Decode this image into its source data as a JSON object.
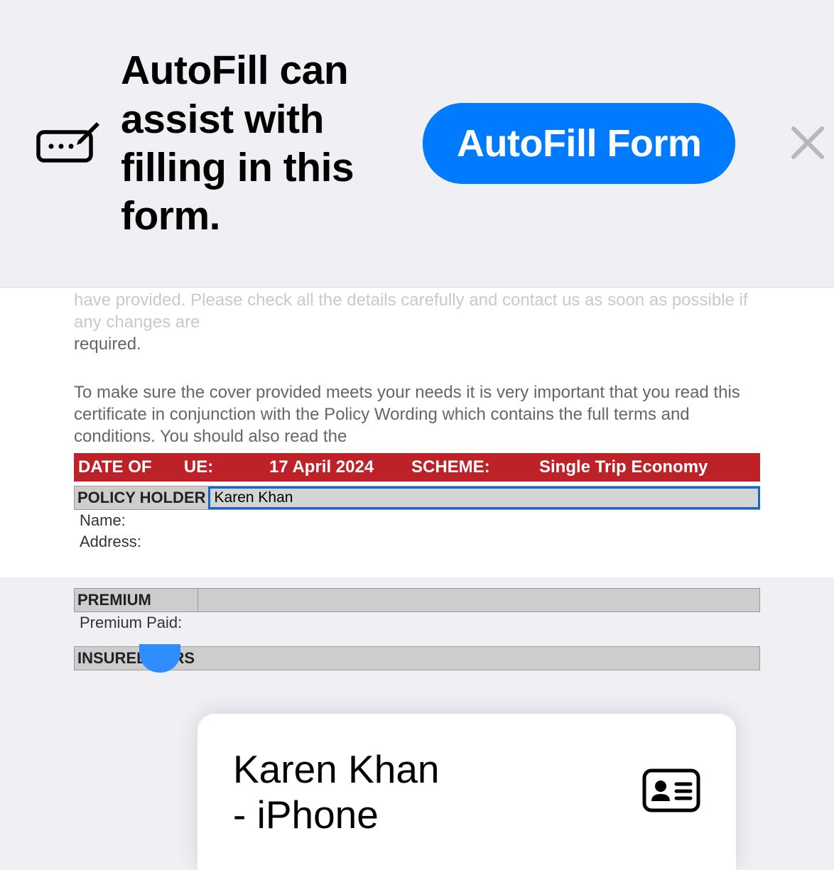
{
  "banner": {
    "message": "AutoFill can assist with filling in this form.",
    "button_label": "AutoFill Form"
  },
  "document": {
    "cutoff_text": "have provided. Please check all the details carefully and contact us as soon as possible if any changes are",
    "para1_cont": "required.",
    "para2": "To make sure the cover provided meets your needs it is very important that you read this certificate in conjunction with the Policy Wording which contains the full terms and conditions. You should also read the",
    "red_bar": {
      "date_label": "DATE OF ISSUE:",
      "date_label_visible": "DATE OF",
      "date_label_tail": "UE:",
      "date_value": "17 April 2024",
      "scheme_label": "SCHEME:",
      "scheme_value": "Single Trip Economy"
    },
    "form": {
      "policy_holder_label": "POLICY HOLDER",
      "policy_holder_value": "Karen Khan",
      "name_label": "Name:",
      "address_label": "Address:",
      "premium_header": "PREMIUM",
      "premium_paid_label": "Premium Paid:",
      "insured_header": "INSURED PERS"
    }
  },
  "suggestion": {
    "name": "Karen Khan",
    "source": "- iPhone"
  }
}
